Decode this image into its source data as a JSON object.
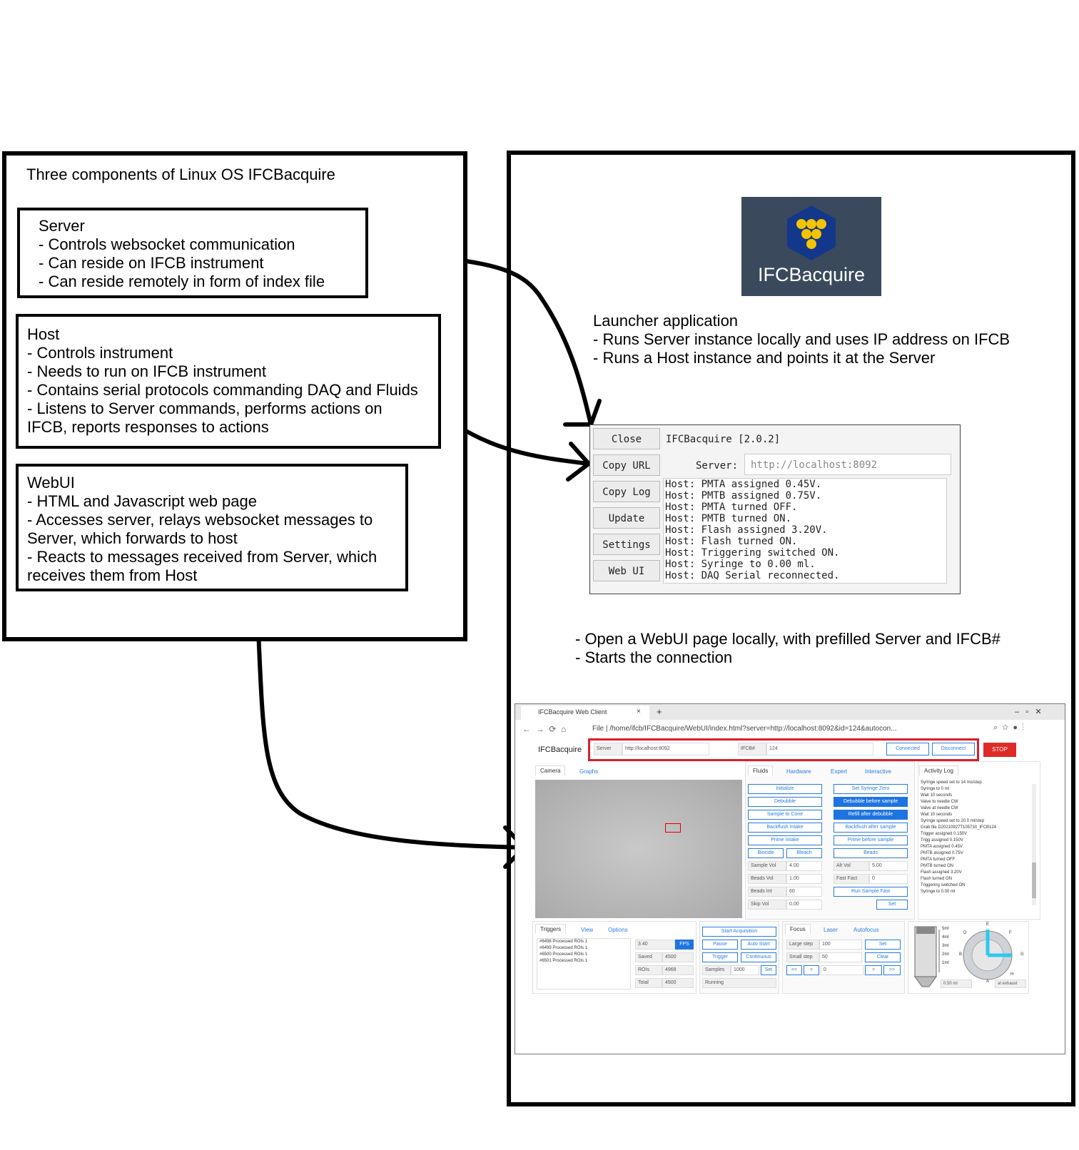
{
  "left_panel": {
    "title": "Three components of Linux OS IFCBacquire",
    "server": {
      "heading": "Server",
      "items": [
        "- Controls websocket communication",
        "- Can reside on IFCB instrument",
        "- Can reside remotely in form of index file"
      ]
    },
    "host": {
      "heading": "Host",
      "items": [
        "- Controls instrument",
        "- Needs to run on IFCB instrument",
        "- Contains serial protocols commanding DAQ and Fluids",
        "- Listens to Server commands, performs actions on",
        "IFCB, reports responses to actions"
      ]
    },
    "webui": {
      "heading": "WebUI",
      "items": [
        "- HTML and Javascript web page",
        "- Accesses server, relays websocket messages to",
        "Server, which forwards to host",
        "- Reacts to messages received from Server, which",
        "receives them from Host"
      ]
    }
  },
  "right_panel": {
    "logo_text": "IFCBacquire",
    "launcher_desc": [
      "Launcher application",
      "- Runs Server instance locally and uses IP address on IFCB",
      "- Runs a Host instance and points it at the Server"
    ],
    "launcher": {
      "buttons": [
        "Close",
        "Copy URL",
        "Copy Log",
        "Update",
        "Settings",
        "Web UI"
      ],
      "title": "IFCBacquire [2.0.2]",
      "server_label": "Server:",
      "server_value": "http://localhost:8092",
      "log": [
        "Host: PMTA assigned 0.45V.",
        "Host: PMTB assigned 0.75V.",
        "Host: PMTA turned OFF.",
        "Host: PMTB turned ON.",
        "Host: Flash assigned 3.20V.",
        "Host: Flash turned ON.",
        "Host: Triggering switched ON.",
        "Host: Syringe to 0.00 ml.",
        "Host: DAQ Serial reconnected."
      ]
    },
    "webui_desc": [
      "- Open a WebUI page locally, with prefilled Server and IFCB#",
      "- Starts the connection"
    ],
    "browser": {
      "tab_title": "IFCBacquire Web Client",
      "tab_close": "×",
      "new_tab": "+",
      "url": "File | /home/ifcb/IFCBacquire/WebUI/index.html?server=http://localhost:8092&id=124&autocon...",
      "app_title": "IFCBacquire",
      "server_label": "Server",
      "server_value": "http://localhost:8092",
      "ifcb_label": "IFCB#",
      "ifcb_value": "124",
      "connected": "Connected",
      "disconnect": "Disconnect",
      "stop": "STOP",
      "camera_tabs": [
        "Camera",
        "Graphs"
      ],
      "fluid_tabs": [
        "Fluids",
        "Hardware",
        "Expert",
        "Interactive"
      ],
      "activity_tab": "Activity Log",
      "fluid_left_buttons": [
        "Initialize",
        "Debubble",
        "Sample to Cone",
        "Backflush Intake",
        "Prime Intake"
      ],
      "fluid_right_buttons": [
        "Set Syringe Zero",
        "Debubble before sample",
        "Refill after debubble",
        "Backflush after sample",
        "Prime before sample"
      ],
      "bleach_buttons": [
        "Biocide",
        "Bleach",
        "Beads"
      ],
      "fluid_fields": [
        {
          "label": "Sample Vol",
          "value": "4.00"
        },
        {
          "label": "Beads Vol",
          "value": "1.00"
        },
        {
          "label": "Beads Int",
          "value": "60"
        },
        {
          "label": "Skip Vol",
          "value": "0.00"
        }
      ],
      "fluid_fields_right": [
        {
          "label": "Alt Vol",
          "value": "5.00"
        },
        {
          "label": "Fast Fact",
          "value": "0"
        }
      ],
      "run_sample_fast": "Run Sample Fast",
      "set_label": "Set",
      "activity_log": [
        "Syringe speed set to 14 ms/step",
        "Syringe to 0 ml",
        "Wait 10 seconds",
        "Valve to needle CW",
        "Valve at needle CW",
        "Wait 10 seconds",
        "Syringe speed set to 20.0 ml/step",
        "Grab file D20210927T105730_IFCB124",
        "Trigger assigned 0.150V",
        "Trigg assigned 0.150V",
        "PMTA assigned 0.45V",
        "PMTB assigned 0.75V",
        "PMTA turned OFF",
        "PMTB turned ON",
        "Flash assigned 3.20V",
        "Flash turned ON",
        "Triggering switched ON",
        "Syringe to 0.00 ml"
      ],
      "trigger_tabs": [
        "Triggers",
        "View",
        "Options"
      ],
      "trigger_rows": [
        "#6498 Processed ROIs 1",
        "#6499 Processed ROIs 1",
        "#6500 Processed ROIs 1",
        "#6501 Processed ROIs 1"
      ],
      "stats": [
        {
          "label": "3.40",
          "value": "FPS"
        },
        {
          "label": "Saved",
          "value": "4500"
        },
        {
          "label": "ROIs",
          "value": "4968"
        },
        {
          "label": "Total",
          "value": "4500"
        }
      ],
      "acq_buttons": [
        "Start Acquisition",
        "Pause",
        "Auto Start",
        "Trigger",
        "Continuous"
      ],
      "samples_label": "Samples",
      "samples_value": "1000",
      "running": "Running",
      "focus_tabs": [
        "Focus",
        "Laser",
        "Autofocus"
      ],
      "focus_fields": [
        {
          "label": "Large step",
          "value": "100",
          "btn": "Set"
        },
        {
          "label": "Small step",
          "value": "50",
          "btn": "Clear"
        }
      ],
      "focus_nav": [
        "<<",
        "<",
        "0",
        ">",
        ">>"
      ],
      "syringe_labels": [
        "5ml",
        "4ml",
        "3ml",
        "2ml",
        "1ml"
      ],
      "syringe_value": "0.50 ml",
      "valve_letters": [
        "E",
        "D",
        "F",
        "G",
        "H",
        "B",
        "A"
      ],
      "valve_state": "at exhaust"
    }
  }
}
